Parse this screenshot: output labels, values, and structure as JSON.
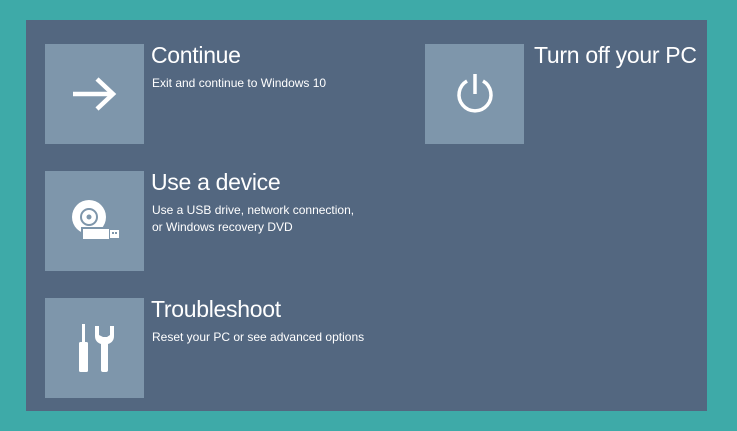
{
  "options": [
    {
      "id": "continue",
      "title": "Continue",
      "description": "Exit and continue to Windows 10",
      "icon": "arrow-right-icon"
    },
    {
      "id": "device",
      "title": "Use a device",
      "description": "Use a USB drive, network connection,\nor Windows recovery DVD",
      "icon": "usb-disc-icon"
    },
    {
      "id": "troubleshoot",
      "title": "Troubleshoot",
      "description": "Reset your PC or see advanced options",
      "icon": "tools-icon"
    },
    {
      "id": "turn-off",
      "title": "Turn off your PC",
      "icon": "power-icon"
    }
  ],
  "colors": {
    "background": "#3eaaa8",
    "panel": "#536780",
    "tile": "#7e96ab",
    "text": "#ffffff"
  }
}
